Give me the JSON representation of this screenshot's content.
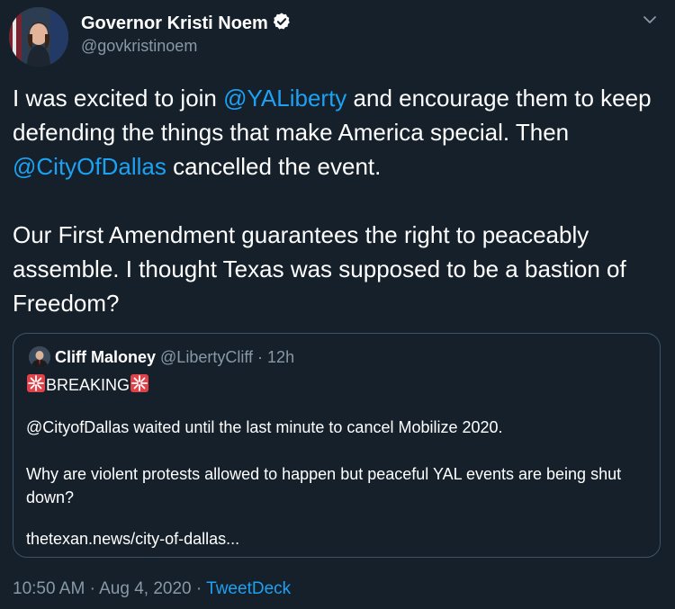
{
  "author": {
    "display_name": "Governor Kristi Noem",
    "handle": "@govkristinoem",
    "verified": true
  },
  "tweet": {
    "p1_part1": "I was excited to join ",
    "p1_mention1": "@YALiberty",
    "p1_part2": " and encourage them to keep defending the things that make America special. Then ",
    "p1_mention2": "@CityOfDallas",
    "p1_part3": " cancelled the event.",
    "p2": "Our First Amendment guarantees the right to peaceably assemble. I thought Texas was supposed to be a bastion of Freedom?"
  },
  "quoted": {
    "name": "Cliff Maloney",
    "handle": "@LibertyCliff",
    "separator": "·",
    "time": "12h",
    "breaking": "BREAKING",
    "text1": "@CityofDallas waited until the last minute to cancel Mobilize 2020.",
    "text2": "Why are violent protests allowed to happen but peaceful YAL events are being shut down?",
    "link": "thetexan.news/city-of-dallas..."
  },
  "meta": {
    "time": "10:50 AM",
    "sep1": "·",
    "date": "Aug 4, 2020",
    "sep2": "·",
    "source": "TweetDeck"
  },
  "colors": {
    "background": "#15202b",
    "accent": "#1da1f2",
    "secondary_text": "#8899a6",
    "border": "#3d5466"
  },
  "icons": [
    "verified-badge-icon",
    "chevron-down-icon",
    "police-siren-icon"
  ]
}
